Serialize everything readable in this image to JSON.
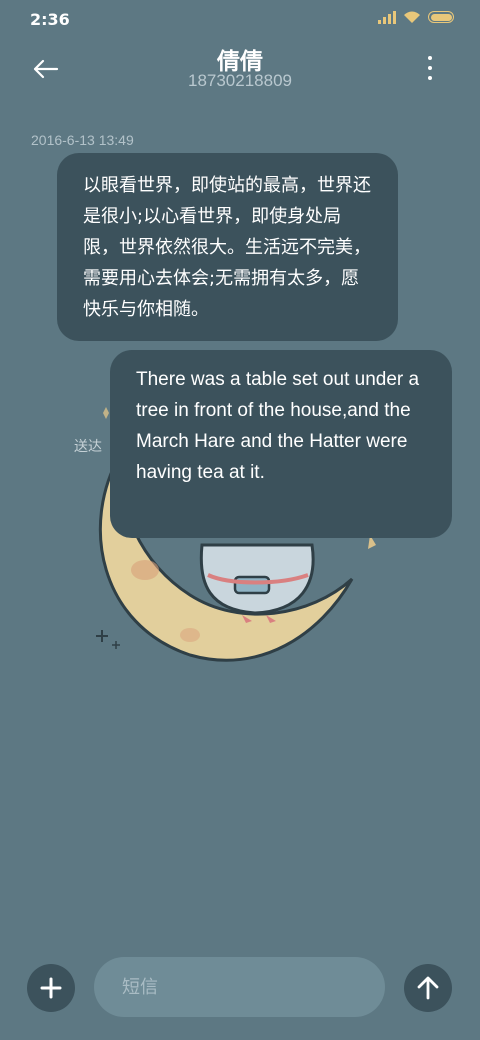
{
  "status_bar": {
    "time": "2:36",
    "icons": [
      "signal-icon",
      "wifi-icon",
      "battery-icon"
    ],
    "icon_color": "#e8c77a"
  },
  "header": {
    "title": "倩倩",
    "phone_number": "18730218809",
    "back_icon": "back-arrow-icon",
    "menu_icon": "more-vertical-icon"
  },
  "conversation": {
    "timestamp": "2016-6-13 13:49",
    "messages": [
      {
        "direction": "received",
        "text": "以眼看世界，即使站的最高，世界还是很小;以心看世界，即使身处局限，世界依然很大。生活远不完美，需要用心去体会;无需拥有太多，愿快乐与你相随。"
      },
      {
        "direction": "sent",
        "text": "There was a table set out under a tree in front of the house,and the March Hare and the Hatter were having tea at it."
      }
    ],
    "delivery_status": "送达"
  },
  "composer": {
    "add_icon": "plus-icon",
    "placeholder": "短信",
    "value": "",
    "send_icon": "send-arrow-icon"
  },
  "colors": {
    "background": "#5d7883",
    "bubble": "#3c525c",
    "input": "#6f8c97"
  }
}
